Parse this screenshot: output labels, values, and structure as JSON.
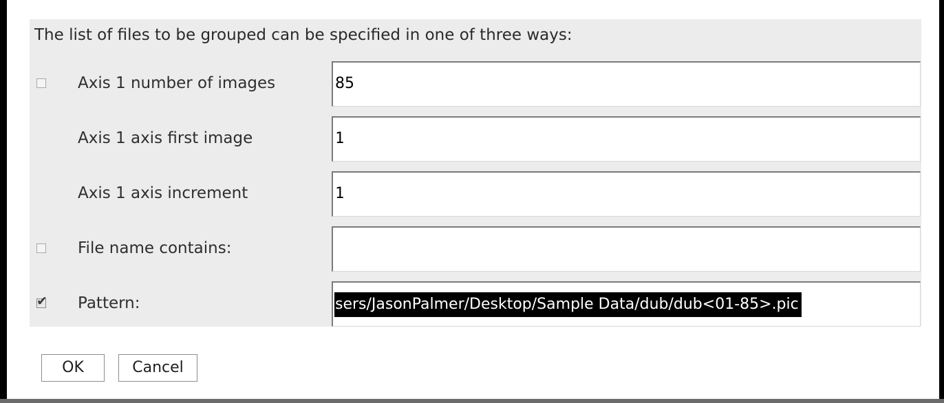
{
  "dialog": {
    "intro": "The list of files to be grouped can be specified in one of three ways:",
    "rows": [
      {
        "label": "Axis 1 number of images",
        "value": "85",
        "checkbox": true,
        "checked": false
      },
      {
        "label": "Axis 1 axis first image",
        "value": "1",
        "checkbox": false
      },
      {
        "label": "Axis 1 axis increment",
        "value": "1",
        "checkbox": false
      },
      {
        "label": "File name contains:",
        "value": "",
        "checkbox": true,
        "checked": false
      },
      {
        "label": "Pattern:",
        "value": "sers/JasonPalmer/Desktop/Sample Data/dub/dub<01-85>.pic",
        "checkbox": true,
        "checked": true
      }
    ],
    "buttons": {
      "ok": "OK",
      "cancel": "Cancel"
    }
  },
  "icons": {
    "checkmark": "✔"
  },
  "colors": {
    "panel": "#ececec",
    "selection_bg": "#000000",
    "selection_fg": "#ffffff"
  }
}
